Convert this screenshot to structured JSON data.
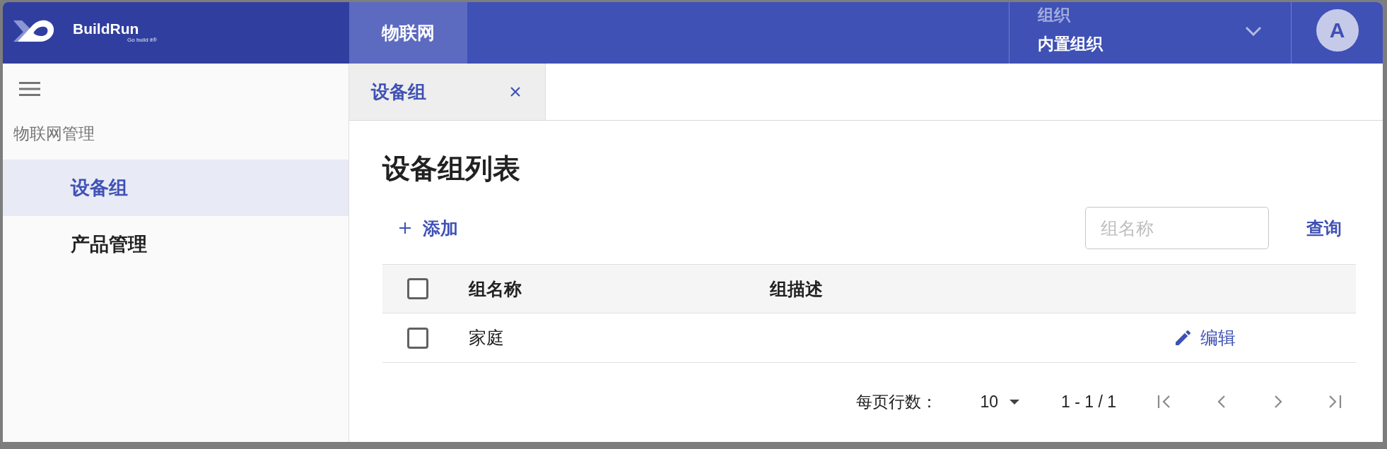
{
  "header": {
    "brand": {
      "name": "BuildRun",
      "tagline": "Go build it®"
    },
    "modules": [
      {
        "label": "物联网",
        "selected": true
      }
    ],
    "org": {
      "label": "组织",
      "value": "内置组织"
    },
    "avatar": "A"
  },
  "sidebar": {
    "section": "物联网管理",
    "items": [
      {
        "label": "设备组",
        "selected": true
      },
      {
        "label": "产品管理",
        "selected": false
      }
    ]
  },
  "tabs": [
    {
      "label": "设备组",
      "selected": true,
      "closable": true
    }
  ],
  "page": {
    "title": "设备组列表",
    "add_button": "添加",
    "search": {
      "placeholder": "组名称"
    },
    "query_button": "查询"
  },
  "table": {
    "select_all_checked": false,
    "columns": [
      "组名称",
      "组描述"
    ],
    "rows": [
      {
        "checked": false,
        "name": "家庭",
        "action": "编辑"
      }
    ]
  },
  "pagination": {
    "rows_per_page_label": "每页行数：",
    "rows_per_page": "10",
    "range": "1 - 1 / 1"
  }
}
